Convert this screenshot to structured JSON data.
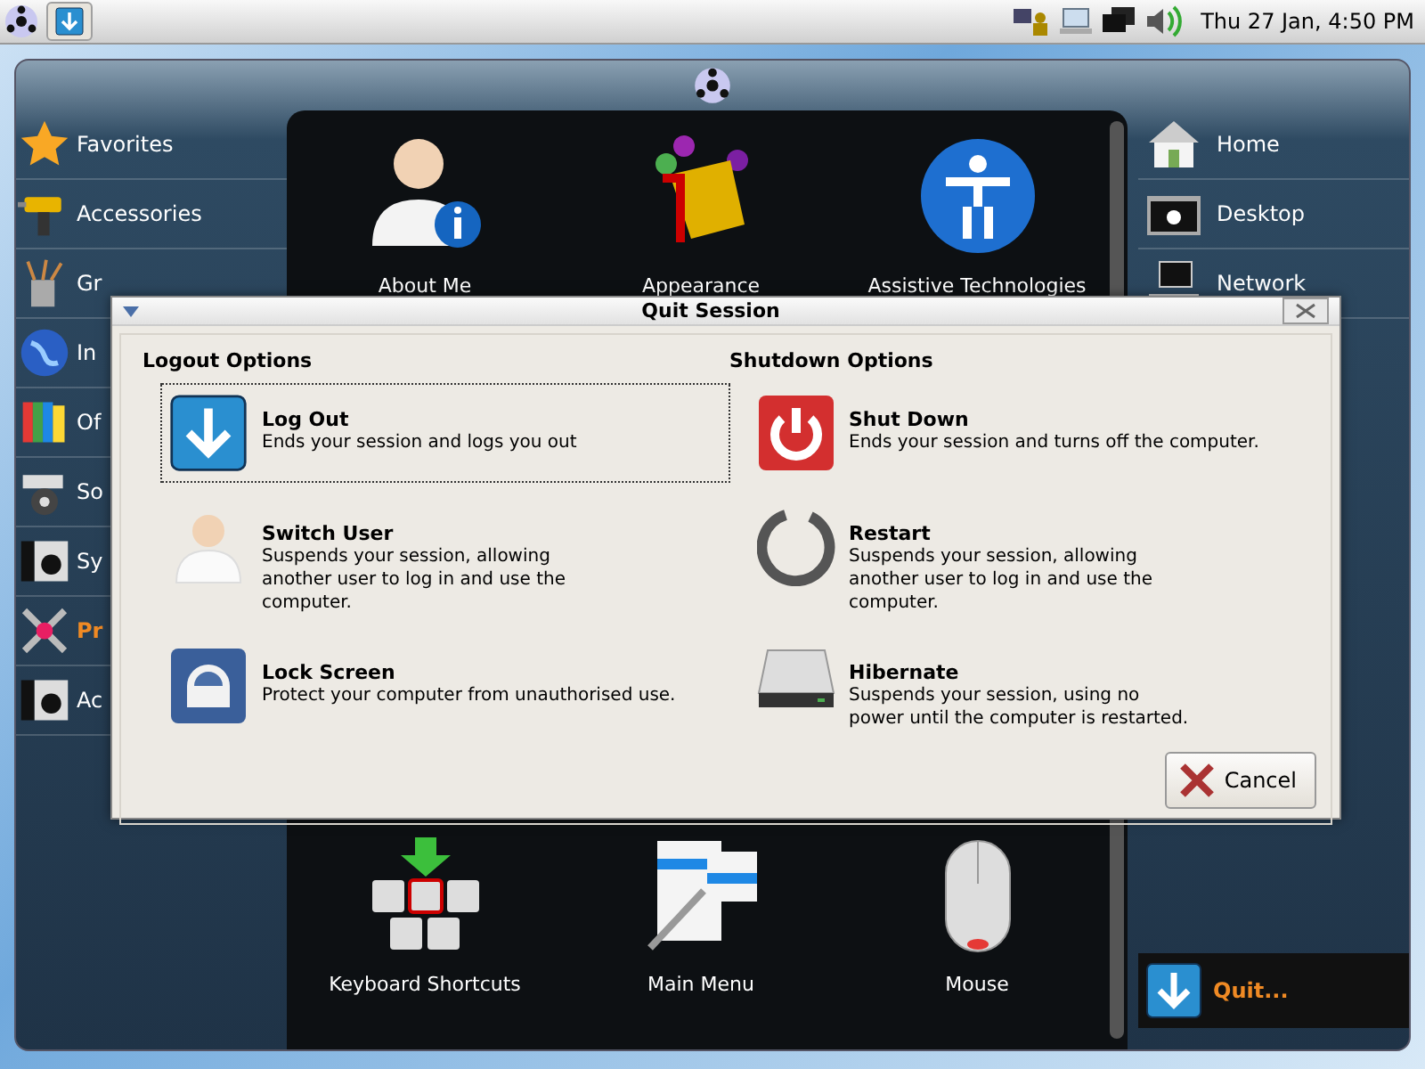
{
  "top_panel": {
    "clock": "Thu 27 Jan,  4:50 PM"
  },
  "menu_window": {
    "categories": [
      {
        "label": "Favorites",
        "selected": false
      },
      {
        "label": "Accessories",
        "selected": false
      },
      {
        "label": "Gr",
        "selected": false
      },
      {
        "label": "In",
        "selected": false
      },
      {
        "label": "Of",
        "selected": false
      },
      {
        "label": "So",
        "selected": false
      },
      {
        "label": "Sy",
        "selected": false
      },
      {
        "label": "Pr",
        "selected": true
      },
      {
        "label": "Ac",
        "selected": false
      }
    ],
    "apps": [
      {
        "label": "About Me"
      },
      {
        "label": "Appearance"
      },
      {
        "label": "Assistive Technologies"
      },
      {
        "label": "Keyboard Shortcuts"
      },
      {
        "label": "Main Menu"
      },
      {
        "label": "Mouse"
      }
    ],
    "places": [
      {
        "label": "Home"
      },
      {
        "label": "Desktop"
      },
      {
        "label": "Network"
      }
    ],
    "quit_button": {
      "label": "Quit..."
    }
  },
  "dialog": {
    "title": "Quit Session",
    "groups": [
      {
        "heading": "Logout Options",
        "options": [
          {
            "title": "Log Out",
            "description": "Ends your session and logs you out",
            "selected": true
          },
          {
            "title": "Switch User",
            "description": "Suspends your session, allowing\nanother user to log in and use the\ncomputer.",
            "selected": false
          },
          {
            "title": "Lock Screen",
            "description": "Protect your computer from unauthorised use.",
            "selected": false
          }
        ]
      },
      {
        "heading": "Shutdown Options",
        "options": [
          {
            "title": "Shut Down",
            "description": "Ends your session and turns off the computer.",
            "selected": false
          },
          {
            "title": "Restart",
            "description": "Suspends your session, allowing\nanother user to log in and use the\ncomputer.",
            "selected": false
          },
          {
            "title": "Hibernate",
            "description": "Suspends your session, using no\npower until the computer is restarted.",
            "selected": false
          }
        ]
      }
    ],
    "cancel": "Cancel"
  }
}
